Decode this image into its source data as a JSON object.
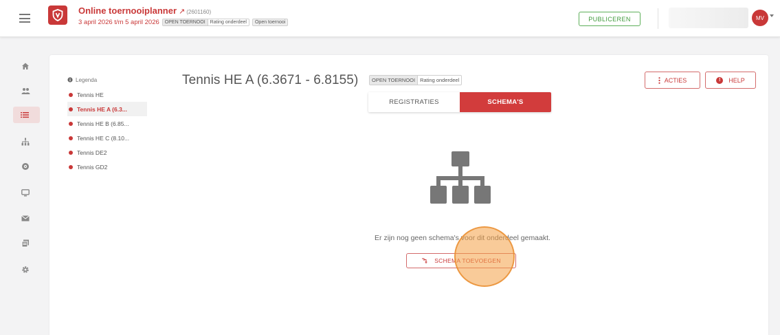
{
  "header": {
    "app_title": "Online toernooiplanner",
    "app_id": "(2601160)",
    "dates": "3 april 2026 t/m 5 april 2026",
    "chip_open": "OPEN TOERNOOI",
    "chip_rating": "Rating onderdeel",
    "chip_type": "Open toernooi",
    "publish_label": "PUBLICEREN",
    "avatar_initials": "MV"
  },
  "sidebar": {
    "items": [
      {
        "icon": "home-icon"
      },
      {
        "icon": "users-icon"
      },
      {
        "icon": "list-icon",
        "active": true
      },
      {
        "icon": "bracket-icon"
      },
      {
        "icon": "target-icon"
      },
      {
        "icon": "monitor-icon"
      },
      {
        "icon": "mail-icon"
      },
      {
        "icon": "documents-icon"
      },
      {
        "icon": "settings-icon"
      }
    ]
  },
  "legend": {
    "title": "Legenda",
    "items": [
      {
        "label": "Tennis HE"
      },
      {
        "label": "Tennis HE A (6.3...",
        "active": true
      },
      {
        "label": "Tennis HE B (6.85..."
      },
      {
        "label": "Tennis HE C (8.10..."
      },
      {
        "label": "Tennis DE2"
      },
      {
        "label": "Tennis GD2"
      }
    ]
  },
  "main": {
    "title": "Tennis HE A (6.3671 - 6.8155)",
    "chip_open": "OPEN TOERNOOI",
    "chip_rating": "Rating onderdeel",
    "acties_label": "ACTIES",
    "help_label": "HELP",
    "tabs": [
      {
        "label": "REGISTRATIES",
        "active": false
      },
      {
        "label": "SCHEMA'S",
        "active": true
      }
    ],
    "empty_message": "Er zijn nog geen schema's voor dit onderdeel gemaakt.",
    "add_schema_label": "SCHEMA TOEVOEGEN"
  },
  "colors": {
    "brand_red": "#c93838",
    "publish_green": "#3f9a3b",
    "cursor_highlight": "#f4a046"
  }
}
